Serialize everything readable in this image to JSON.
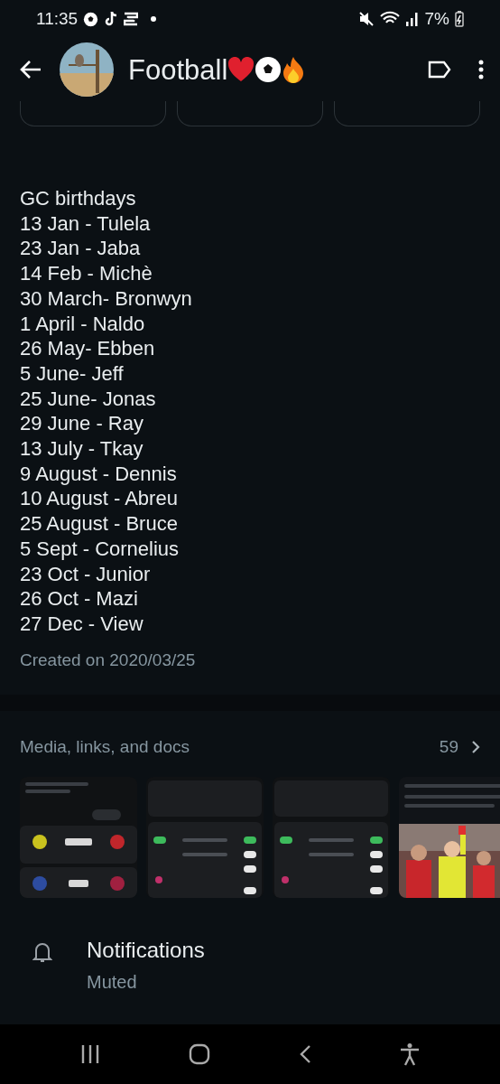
{
  "status_bar": {
    "time": "11:35",
    "battery": "7%"
  },
  "header": {
    "title": "Football"
  },
  "description": {
    "lines": [
      "GC birthdays",
      "13 Jan - Tulela",
      "23 Jan - Jaba",
      "14 Feb - Michè",
      "30 March- Bronwyn",
      "1 April - Naldo",
      "26 May- Ebben",
      "5 June- Jeff",
      "25 June- Jonas",
      "29 June - Ray",
      "13 July - Tkay",
      "9 August - Dennis",
      "10 August - Abreu",
      "25 August - Bruce",
      "5 Sept - Cornelius",
      "23 Oct - Junior",
      "26 Oct - Mazi",
      "27 Dec - View"
    ],
    "created": "Created on 2020/03/25"
  },
  "media": {
    "title": "Media, links, and docs",
    "count": "59"
  },
  "settings": [
    {
      "kind": "notifications",
      "label": "Notifications",
      "value": "Muted"
    }
  ]
}
